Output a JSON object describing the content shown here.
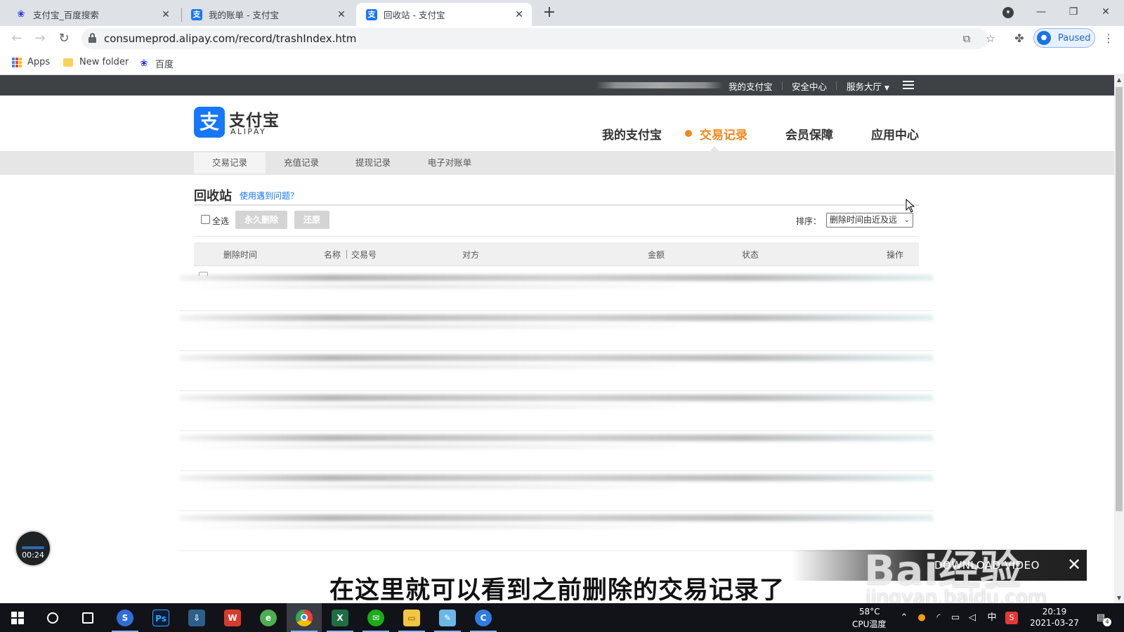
{
  "browser": {
    "tabs": [
      {
        "title": "支付宝_百度搜索",
        "favicon": "baidu-paw-icon",
        "active": false
      },
      {
        "title": "我的账单 - 支付宝",
        "favicon": "alipay-icon",
        "active": false
      },
      {
        "title": "回收站 - 支付宝",
        "favicon": "alipay-icon",
        "active": true
      }
    ],
    "url": "consumeprod.alipay.com/record/trashIndex.htm",
    "profile_status": "Paused",
    "bookmarks": [
      {
        "label": "Apps",
        "icon": "apps-grid-icon"
      },
      {
        "label": "New folder",
        "icon": "folder-icon"
      },
      {
        "label": "百度",
        "icon": "baidu-paw-icon"
      }
    ]
  },
  "site": {
    "top_links": [
      "我的支付宝",
      "安全中心",
      "服务大厅"
    ],
    "logo_cn": "支付宝",
    "logo_en": "ALIPAY",
    "main_nav": [
      {
        "label": "我的支付宝",
        "active": false
      },
      {
        "label": "交易记录",
        "active": true
      },
      {
        "label": "会员保障",
        "active": false
      },
      {
        "label": "应用中心",
        "active": false
      }
    ],
    "sub_nav": [
      {
        "label": "交易记录",
        "active": true
      },
      {
        "label": "充值记录",
        "active": false
      },
      {
        "label": "提现记录",
        "active": false
      },
      {
        "label": "电子对账单",
        "active": false
      }
    ],
    "accent_color": "#f7861b",
    "brand_color": "#1677ff"
  },
  "trash": {
    "title": "回收站",
    "help_link": "使用遇到问题？",
    "select_all": "全选",
    "delete_button": "永久删除",
    "restore_button": "还原",
    "sort_label": "排序：",
    "sort_value": "删除时间由近及远",
    "columns": {
      "delete_time": "删除时间",
      "name": "名称",
      "trade_no": "交易号",
      "counterparty": "对方",
      "amount": "金额",
      "status": "状态",
      "action": "操作"
    }
  },
  "overlay": {
    "timer": "00:24",
    "subtitle": "在这里就可以看到之前删除的交易记录了",
    "download_video": "DOWNLOAD VIDEO",
    "watermark_main": "Bai经验",
    "watermark_sub": "jingyan.baidu.com"
  },
  "taskbar": {
    "apps": [
      "sogou-icon",
      "photoshop-icon",
      "installer-icon",
      "wps-icon",
      "browser-360-icon",
      "chrome-icon",
      "excel-icon",
      "wechat-icon",
      "file-explorer-icon",
      "notepad-icon",
      "app-c-icon"
    ],
    "temperature": "58°C",
    "temperature_label": "CPU温度",
    "ime": "中",
    "time": "20:19",
    "date": "2021-03-27",
    "notification_count": "4"
  }
}
